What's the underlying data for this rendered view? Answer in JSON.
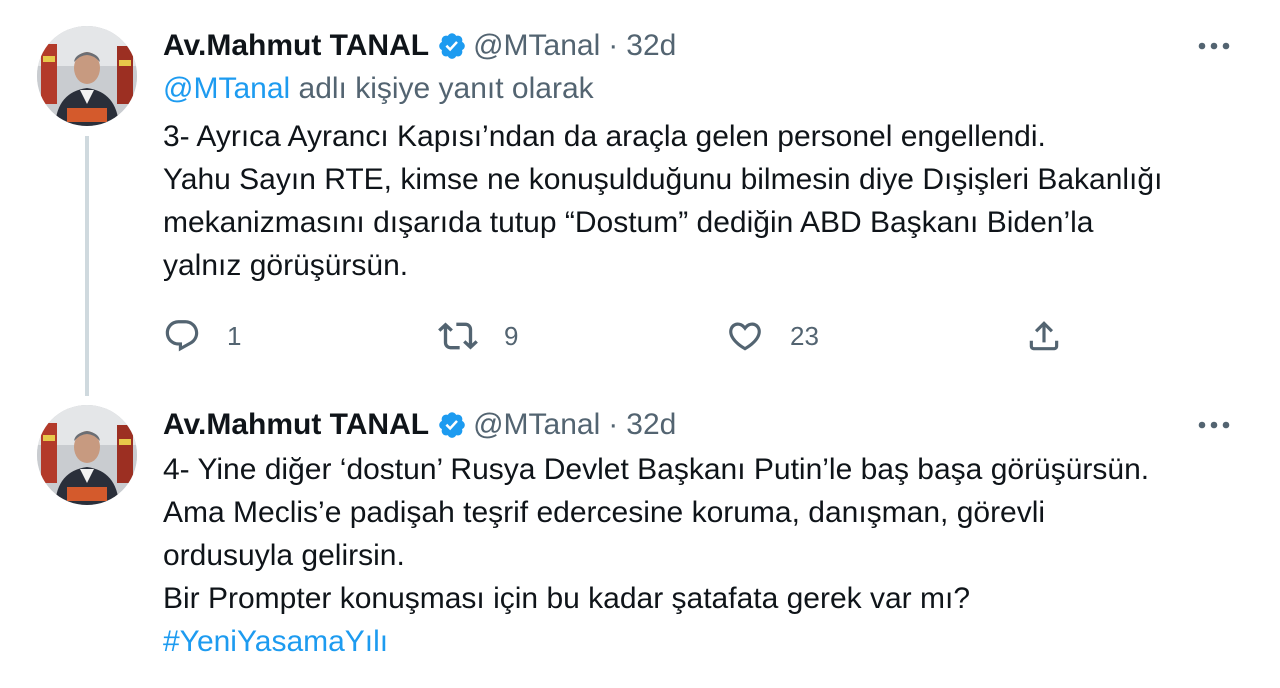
{
  "tweets": [
    {
      "author_name": "Av.Mahmut TANAL",
      "handle": "@MTanal",
      "separator": "·",
      "time": "32d",
      "reply_context": {
        "mention": "@MTanal",
        "suffix": " adlı kişiye yanıt olarak"
      },
      "lines": [
        "3- Ayrıca Ayrancı Kapısı’ndan da araçla gelen personel engellendi.",
        "Yahu Sayın RTE, kimse ne konuşulduğunu bilmesin diye Dışişleri Bakanlığı",
        "mekanizmasını dışarıda tutup “Dostum” dediğin ABD Başkanı Biden’la",
        "yalnız görüşürsün."
      ],
      "stats": {
        "replies": "1",
        "retweets": "9",
        "likes": "23"
      }
    },
    {
      "author_name": "Av.Mahmut TANAL",
      "handle": "@MTanal",
      "separator": "·",
      "time": "32d",
      "lines": [
        "4- Yine diğer ‘dostun’ Rusya Devlet Başkanı Putin’le baş başa görüşürsün.",
        "Ama Meclis’e padişah teşrif edercesine koruma, danışman, görevli",
        "ordusuyla gelirsin.",
        "Bir Prompter konuşması için bu kadar şatafata gerek var mı?"
      ],
      "hashtag": "#YeniYasamaYılı"
    }
  ],
  "icons": {
    "verified": "verified-badge-icon",
    "more": "more-options-icon",
    "reply": "reply-icon",
    "retweet": "retweet-icon",
    "like": "like-icon",
    "share": "share-icon"
  },
  "colors": {
    "accent": "#1d9bf0",
    "text": "#0f1419",
    "muted": "#536471",
    "thread_line": "#cfd9de"
  }
}
